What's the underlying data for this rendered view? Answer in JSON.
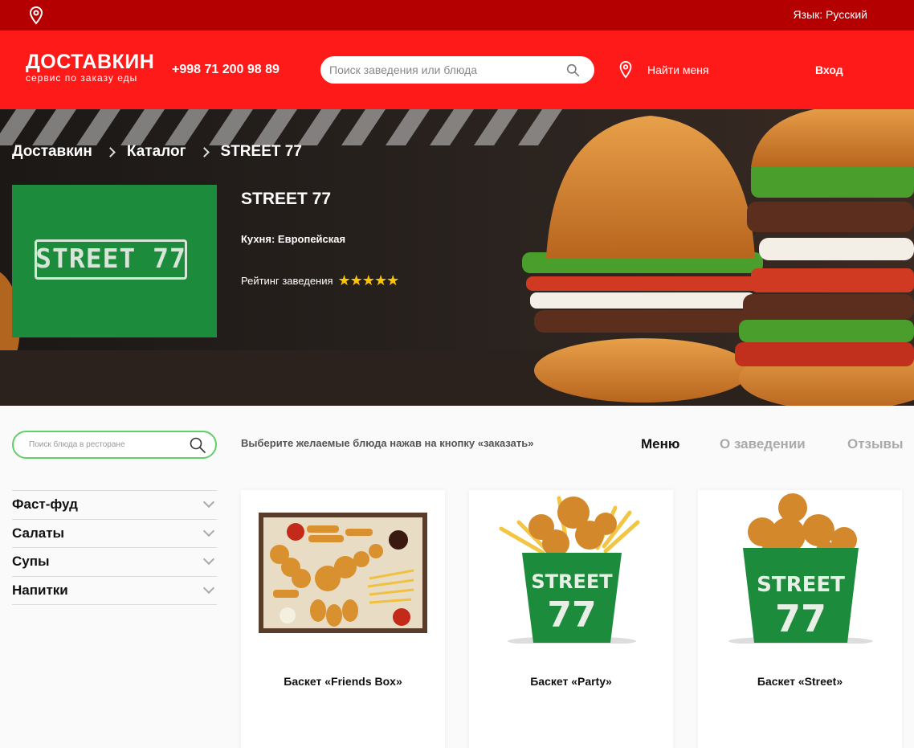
{
  "topbar": {
    "language": "Язык: Русский",
    "location_icon": "map-pin-icon"
  },
  "header": {
    "logo_name": "ДОСТАВКИН",
    "logo_tagline": "сервис по заказу еды",
    "phone": "+998 71 200 98 89",
    "search_placeholder": "Поиск заведения или блюда",
    "find_me": "Найти меня",
    "login": "Вход"
  },
  "breadcrumbs": [
    "Доставкин",
    "Каталог",
    "STREET 77"
  ],
  "restaurant": {
    "logo_text": "STREET 77",
    "name": "STREET 77",
    "cuisine": "Кухня: Европейская",
    "rating_label": "Рейтинг заведения",
    "rating_stars": "★★★★★"
  },
  "content": {
    "dish_search_placeholder": "Поиск блюда в ресторане",
    "hint": "Выберите желаемые блюда нажав на кнопку «заказать»",
    "tabs": [
      "Меню",
      "О заведении",
      "Отзывы"
    ],
    "categories": [
      "Фаст-фуд",
      "Салаты",
      "Супы",
      "Напитки"
    ],
    "products": [
      "Баскет «Friends Box»",
      "Баскет «Party»",
      "Баскет «Street»"
    ]
  },
  "colors": {
    "topbar": "#b40000",
    "header": "#ff1a1a",
    "accent_green": "#5fcf68",
    "star": "#ffc400"
  }
}
